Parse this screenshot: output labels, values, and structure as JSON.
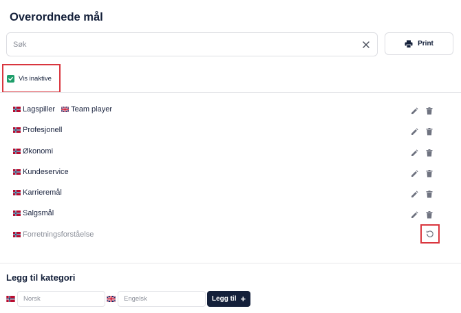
{
  "page": {
    "title": "Overordnede mål"
  },
  "search": {
    "placeholder": "Søk",
    "value": ""
  },
  "toolbar": {
    "print_label": "Print"
  },
  "filter": {
    "show_inactive_label": "Vis inaktive",
    "show_inactive_checked": true
  },
  "goals": [
    {
      "label": "Lagspiller",
      "flag": "norway-flag",
      "secondary_label": "Team player",
      "secondary_flag": "uk-flag",
      "active": true
    },
    {
      "label": "Profesjonell",
      "flag": "norway-flag",
      "active": true
    },
    {
      "label": "Økonomi",
      "flag": "norway-flag",
      "active": true
    },
    {
      "label": "Kundeservice",
      "flag": "norway-flag",
      "active": true
    },
    {
      "label": "Karrieremål",
      "flag": "norway-flag",
      "active": true
    },
    {
      "label": "Salgsmål",
      "flag": "norway-flag",
      "active": true
    },
    {
      "label": "Forretningsforståelse",
      "flag": "norway-flag",
      "active": false
    }
  ],
  "add_category": {
    "title": "Legg til kategori",
    "norwegian_placeholder": "Norsk",
    "english_placeholder": "Engelsk",
    "add_label": "Legg til",
    "add_icon": "plus-icon"
  },
  "colors": {
    "accent": "#14203a",
    "checkbox": "#1e9e6a",
    "highlight": "#d9363e",
    "inactive_text": "#8b8f99",
    "icon": "#6f7380"
  }
}
